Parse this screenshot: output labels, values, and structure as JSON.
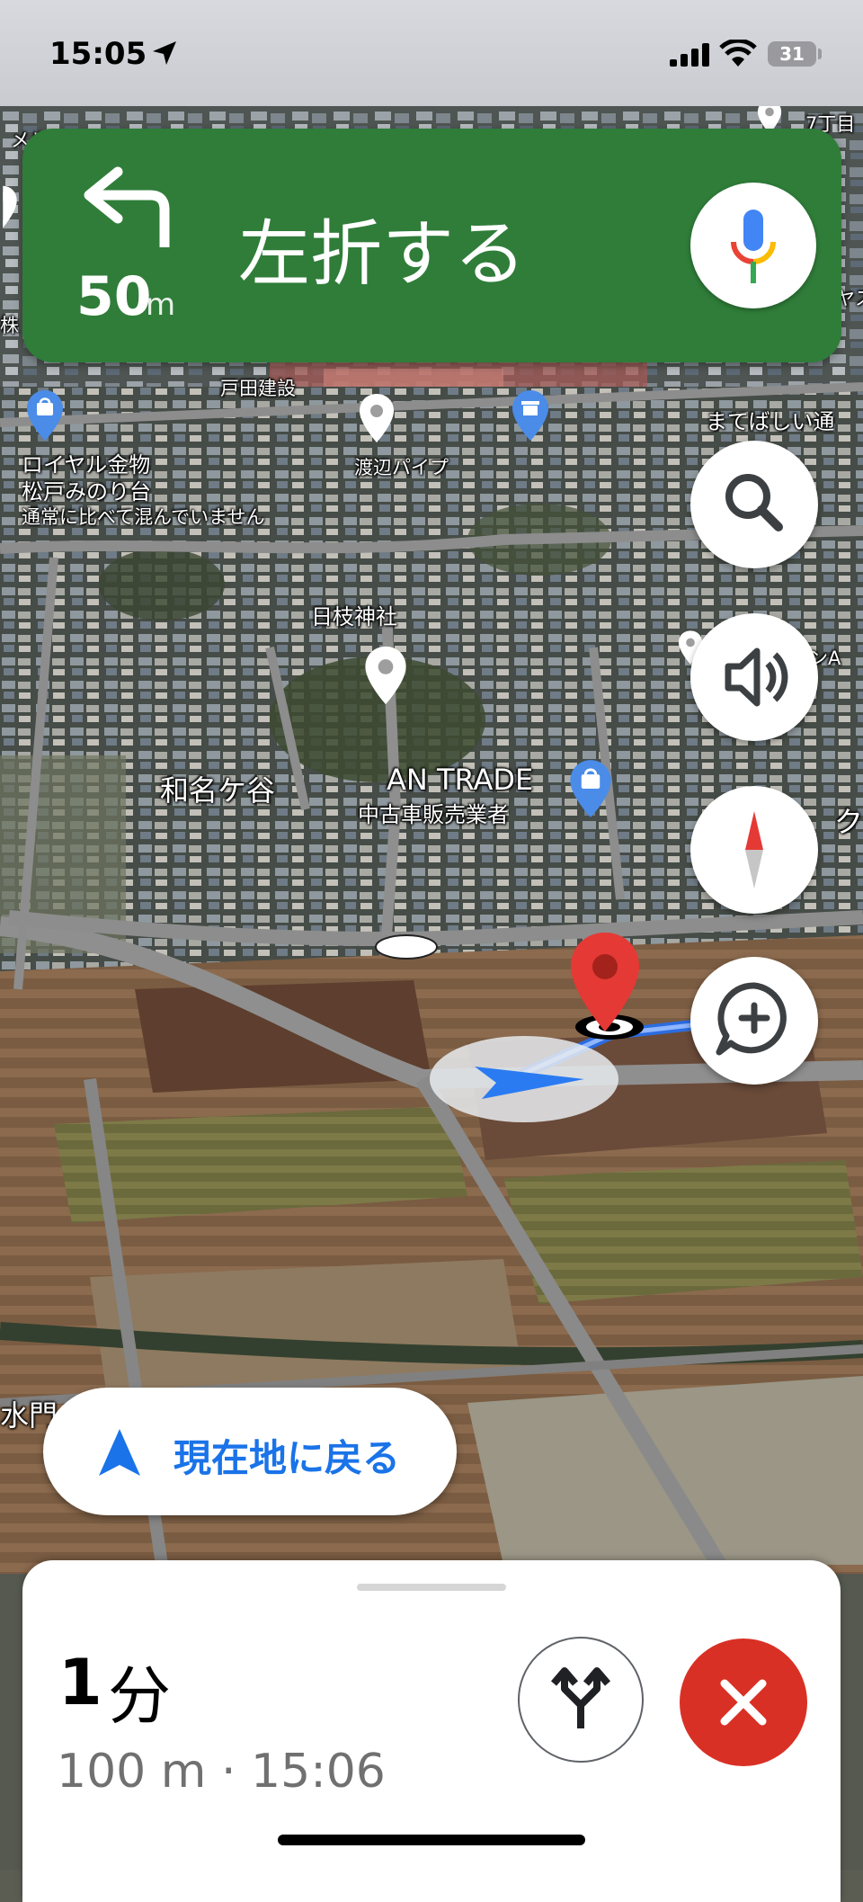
{
  "status_bar": {
    "time": "15:05",
    "battery": "31",
    "icons": [
      "location-arrow-icon",
      "signal-icon",
      "wifi-icon",
      "battery-icon"
    ]
  },
  "navigation": {
    "distance_value": "50",
    "distance_unit": "m",
    "instruction": "左折する",
    "turn_icon": "turn-left-icon",
    "mic_icon": "google-mic-icon"
  },
  "map": {
    "labels": {
      "toda_kensetsu": "戸田建設",
      "royal_kinmotsu": "ロイヤル金物",
      "matsudo_minoridai": "松戸みのり台",
      "not_crowded": "通常に比べて混んでいません",
      "watanabe_pipe": "渡辺パイプ",
      "matebashii": "まてばしい通",
      "hie_jinja": "日枝神社",
      "wanagaya": "和名ケ谷",
      "an_trade": "AN TRADE",
      "used_car_dealer": "中古車販売業者",
      "chome7": "7丁目",
      "edge_a": "ンA",
      "edge_k": "ク",
      "edge_yatsu": "ヤス",
      "edge_kabu": "株",
      "edge_mei": "メル",
      "mizumon": "水門"
    }
  },
  "controls": {
    "search_icon": "search-icon",
    "sound_icon": "volume-icon",
    "compass_icon": "compass-icon",
    "report_icon": "add-comment-icon"
  },
  "recenter": {
    "label": "現在地に戻る"
  },
  "trip": {
    "eta_value": "1",
    "eta_unit": "分",
    "summary": "100 m · 15:06"
  },
  "colors": {
    "banner_green": "#2f7d39",
    "accent_blue": "#1a73e8",
    "exit_red": "#d93025"
  }
}
